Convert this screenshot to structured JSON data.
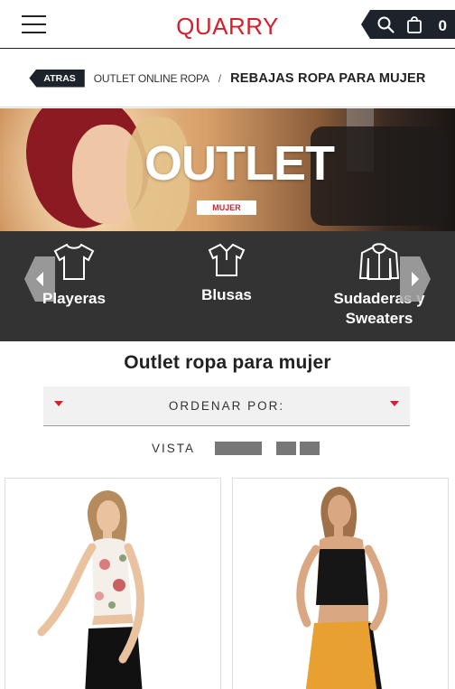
{
  "header": {
    "logo": "QUARRY",
    "cart_count": "0"
  },
  "breadcrumb": {
    "back": "ATRAS",
    "parent": "OUTLET ONLINE ROPA",
    "separator": "/",
    "current": "REBAJAS ROPA PARA MUJER"
  },
  "banner": {
    "title": "OUTLET",
    "badge": "MUJER"
  },
  "categories": {
    "items": [
      {
        "label": "Playeras",
        "icon": "tshirt-icon"
      },
      {
        "label": "Blusas",
        "icon": "polo-blouse-icon"
      },
      {
        "label": "Sudaderas y Sweaters",
        "icon": "hoodie-icon"
      }
    ]
  },
  "listing": {
    "title": "Outlet ropa para mujer",
    "sort_label": "ORDENAR POR:",
    "view_label": "VISTA"
  },
  "colors": {
    "brand": "#d81e2c",
    "dark": "#1c232b",
    "category_bar": "#333333"
  }
}
